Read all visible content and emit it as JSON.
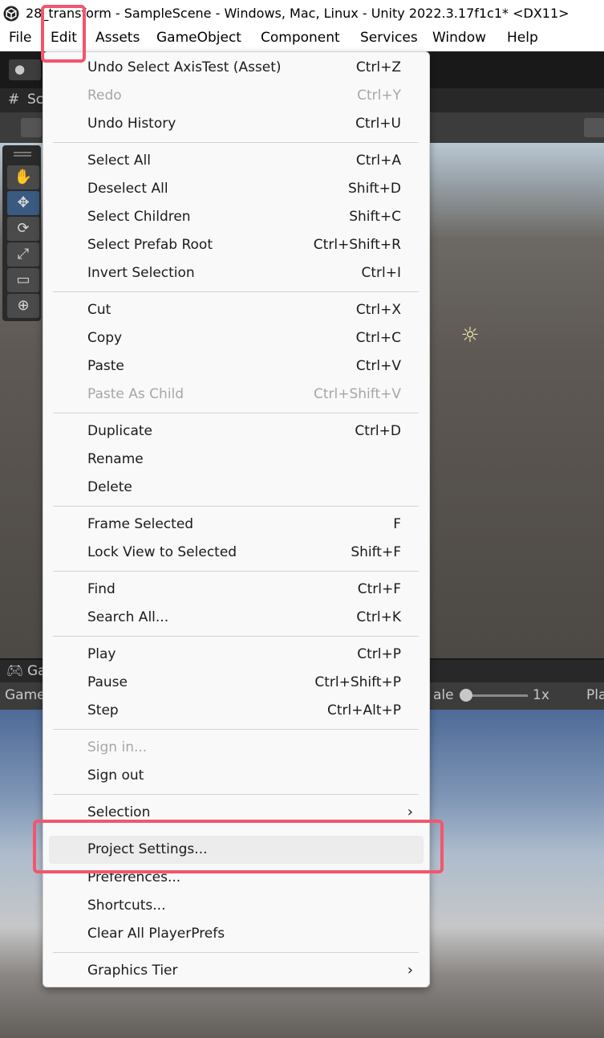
{
  "window": {
    "title": "28_transform - SampleScene - Windows, Mac, Linux - Unity 2022.3.17f1c1* <DX11>"
  },
  "menubar": [
    "File",
    "Edit",
    "Assets",
    "GameObject",
    "Component",
    "Services",
    "Window",
    "Help"
  ],
  "editor": {
    "scene_tab": "Sc",
    "game_tab": "Ga",
    "game_dropdown": "Game",
    "scale_label": "ale",
    "scale_value": "1x",
    "play_label": "Pla"
  },
  "edit_menu": {
    "items": [
      {
        "label": "Undo Select AxisTest (Asset)",
        "shortcut": "Ctrl+Z"
      },
      {
        "label": "Redo",
        "shortcut": "Ctrl+Y",
        "disabled": true
      },
      {
        "label": "Undo History",
        "shortcut": "Ctrl+U"
      },
      {
        "label": "Select All",
        "shortcut": "Ctrl+A"
      },
      {
        "label": "Deselect All",
        "shortcut": "Shift+D"
      },
      {
        "label": "Select Children",
        "shortcut": "Shift+C"
      },
      {
        "label": "Select Prefab Root",
        "shortcut": "Ctrl+Shift+R"
      },
      {
        "label": "Invert Selection",
        "shortcut": "Ctrl+I"
      },
      {
        "label": "Cut",
        "shortcut": "Ctrl+X"
      },
      {
        "label": "Copy",
        "shortcut": "Ctrl+C"
      },
      {
        "label": "Paste",
        "shortcut": "Ctrl+V"
      },
      {
        "label": "Paste As Child",
        "shortcut": "Ctrl+Shift+V",
        "disabled": true
      },
      {
        "label": "Duplicate",
        "shortcut": "Ctrl+D"
      },
      {
        "label": "Rename",
        "shortcut": ""
      },
      {
        "label": "Delete",
        "shortcut": ""
      },
      {
        "label": "Frame Selected",
        "shortcut": "F"
      },
      {
        "label": "Lock View to Selected",
        "shortcut": "Shift+F"
      },
      {
        "label": "Find",
        "shortcut": "Ctrl+F"
      },
      {
        "label": "Search All...",
        "shortcut": "Ctrl+K"
      },
      {
        "label": "Play",
        "shortcut": "Ctrl+P"
      },
      {
        "label": "Pause",
        "shortcut": "Ctrl+Shift+P"
      },
      {
        "label": "Step",
        "shortcut": "Ctrl+Alt+P"
      },
      {
        "label": "Sign in...",
        "shortcut": "",
        "disabled": true
      },
      {
        "label": "Sign out",
        "shortcut": ""
      },
      {
        "label": "Selection",
        "shortcut": "",
        "submenu": true
      },
      {
        "label": "Project Settings...",
        "shortcut": "",
        "highlighted": true
      },
      {
        "label": "Preferences...",
        "shortcut": ""
      },
      {
        "label": "Shortcuts...",
        "shortcut": ""
      },
      {
        "label": "Clear All PlayerPrefs",
        "shortcut": ""
      },
      {
        "label": "Graphics Tier",
        "shortcut": "",
        "submenu": true
      }
    ]
  },
  "colors": {
    "highlight": "#f2566c",
    "menu_bg": "#f9f9f9",
    "disabled_text": "#a6a6a6"
  }
}
